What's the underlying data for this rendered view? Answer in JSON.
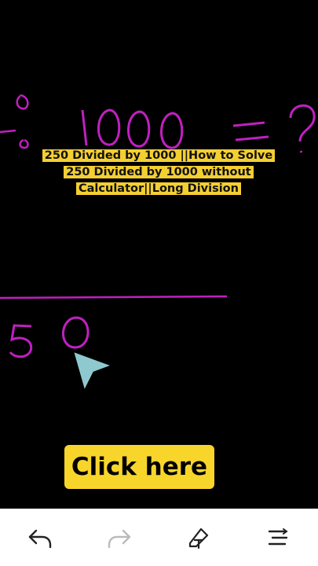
{
  "video": {
    "caption": "250 Divided by 1000 ||How to Solve 250 Divided by 1000 without Calculator||Long Division",
    "cta_label": "Click here"
  },
  "colors": {
    "ink": "#c020c0",
    "cursor": "#8ec9cf",
    "caption_bg": "#f4cf32",
    "cta_bg": "#f8d52b"
  },
  "toolbar": {
    "items": [
      {
        "name": "undo-icon",
        "enabled": true
      },
      {
        "name": "redo-icon",
        "enabled": false
      },
      {
        "name": "pen-tool-icon",
        "enabled": true
      },
      {
        "name": "menu-lines-icon",
        "enabled": true
      }
    ]
  }
}
